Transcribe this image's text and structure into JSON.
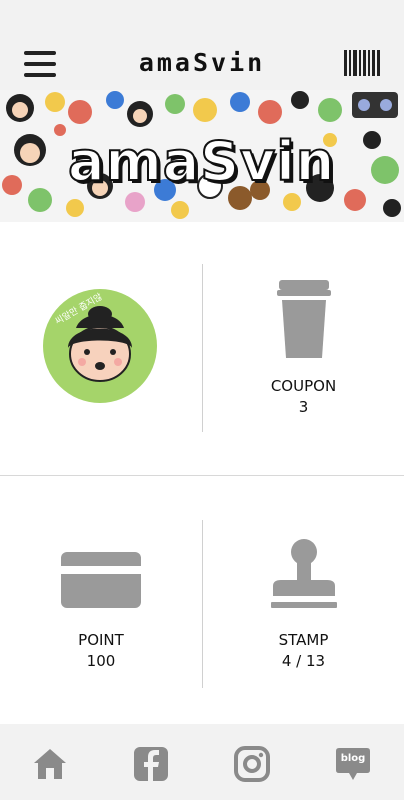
{
  "header": {
    "title": "amaSvin",
    "menu_icon": "hamburger-menu-icon",
    "barcode_icon": "barcode-icon"
  },
  "banner": {
    "logo_text": "amaSvin"
  },
  "profile": {
    "avatar_caption": "씨알만 줍지않",
    "avatar_bg": "#a5d46a"
  },
  "coupon": {
    "label": "COUPON",
    "value": "3",
    "icon": "cup-icon"
  },
  "point": {
    "label": "POINT",
    "value": "100",
    "icon": "card-icon"
  },
  "stamp": {
    "label": "STAMP",
    "value": "4 / 13",
    "icon": "stamp-icon"
  },
  "bottom_nav": {
    "items": [
      {
        "name": "home",
        "icon": "home-icon"
      },
      {
        "name": "facebook",
        "icon": "facebook-icon"
      },
      {
        "name": "instagram",
        "icon": "instagram-icon"
      },
      {
        "name": "blog",
        "icon": "blog-icon",
        "label": "blog"
      }
    ]
  },
  "colors": {
    "icon_gray": "#9a9a9a",
    "bar_bg": "#f2f2f2"
  }
}
